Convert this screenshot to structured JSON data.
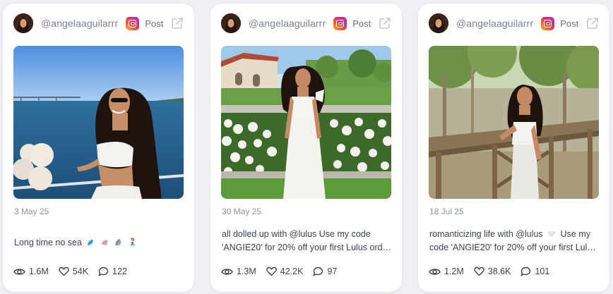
{
  "posts": [
    {
      "handle": "@angelaaguilarrr",
      "platform": "instagram-icon",
      "post_label": "Post",
      "date": "3 May 25",
      "caption_line1": "Long time no sea",
      "caption_line2": "",
      "views": "1.6M",
      "likes": "54K",
      "comments": "122"
    },
    {
      "handle": "@angelaaguilarrr",
      "platform": "instagram-icon",
      "post_label": "Post",
      "date": "30 May 25",
      "caption_line1": "all dolled up with @lulus Use my code",
      "caption_line2": "'ANGIE20' for 20% off your first Lulus orde...",
      "views": "1.3M",
      "likes": "42.2K",
      "comments": "97"
    },
    {
      "handle": "@angelaaguilarrr",
      "platform": "instagram-icon",
      "post_label": "Post",
      "date": "18 Jul 25",
      "caption_line1": "romanticizing life with @lulus",
      "caption_line2": "'ANGIE20' for 20% off your first Lulus...",
      "caption_line1_tail": "Use my",
      "caption_line2_prefix": "code",
      "views": "1.2M",
      "likes": "38.6K",
      "comments": "101"
    }
  ],
  "colors": {
    "background": "#eef0f5",
    "card": "#ffffff",
    "muted_text": "#7c8293",
    "body_text": "#3e4352"
  }
}
